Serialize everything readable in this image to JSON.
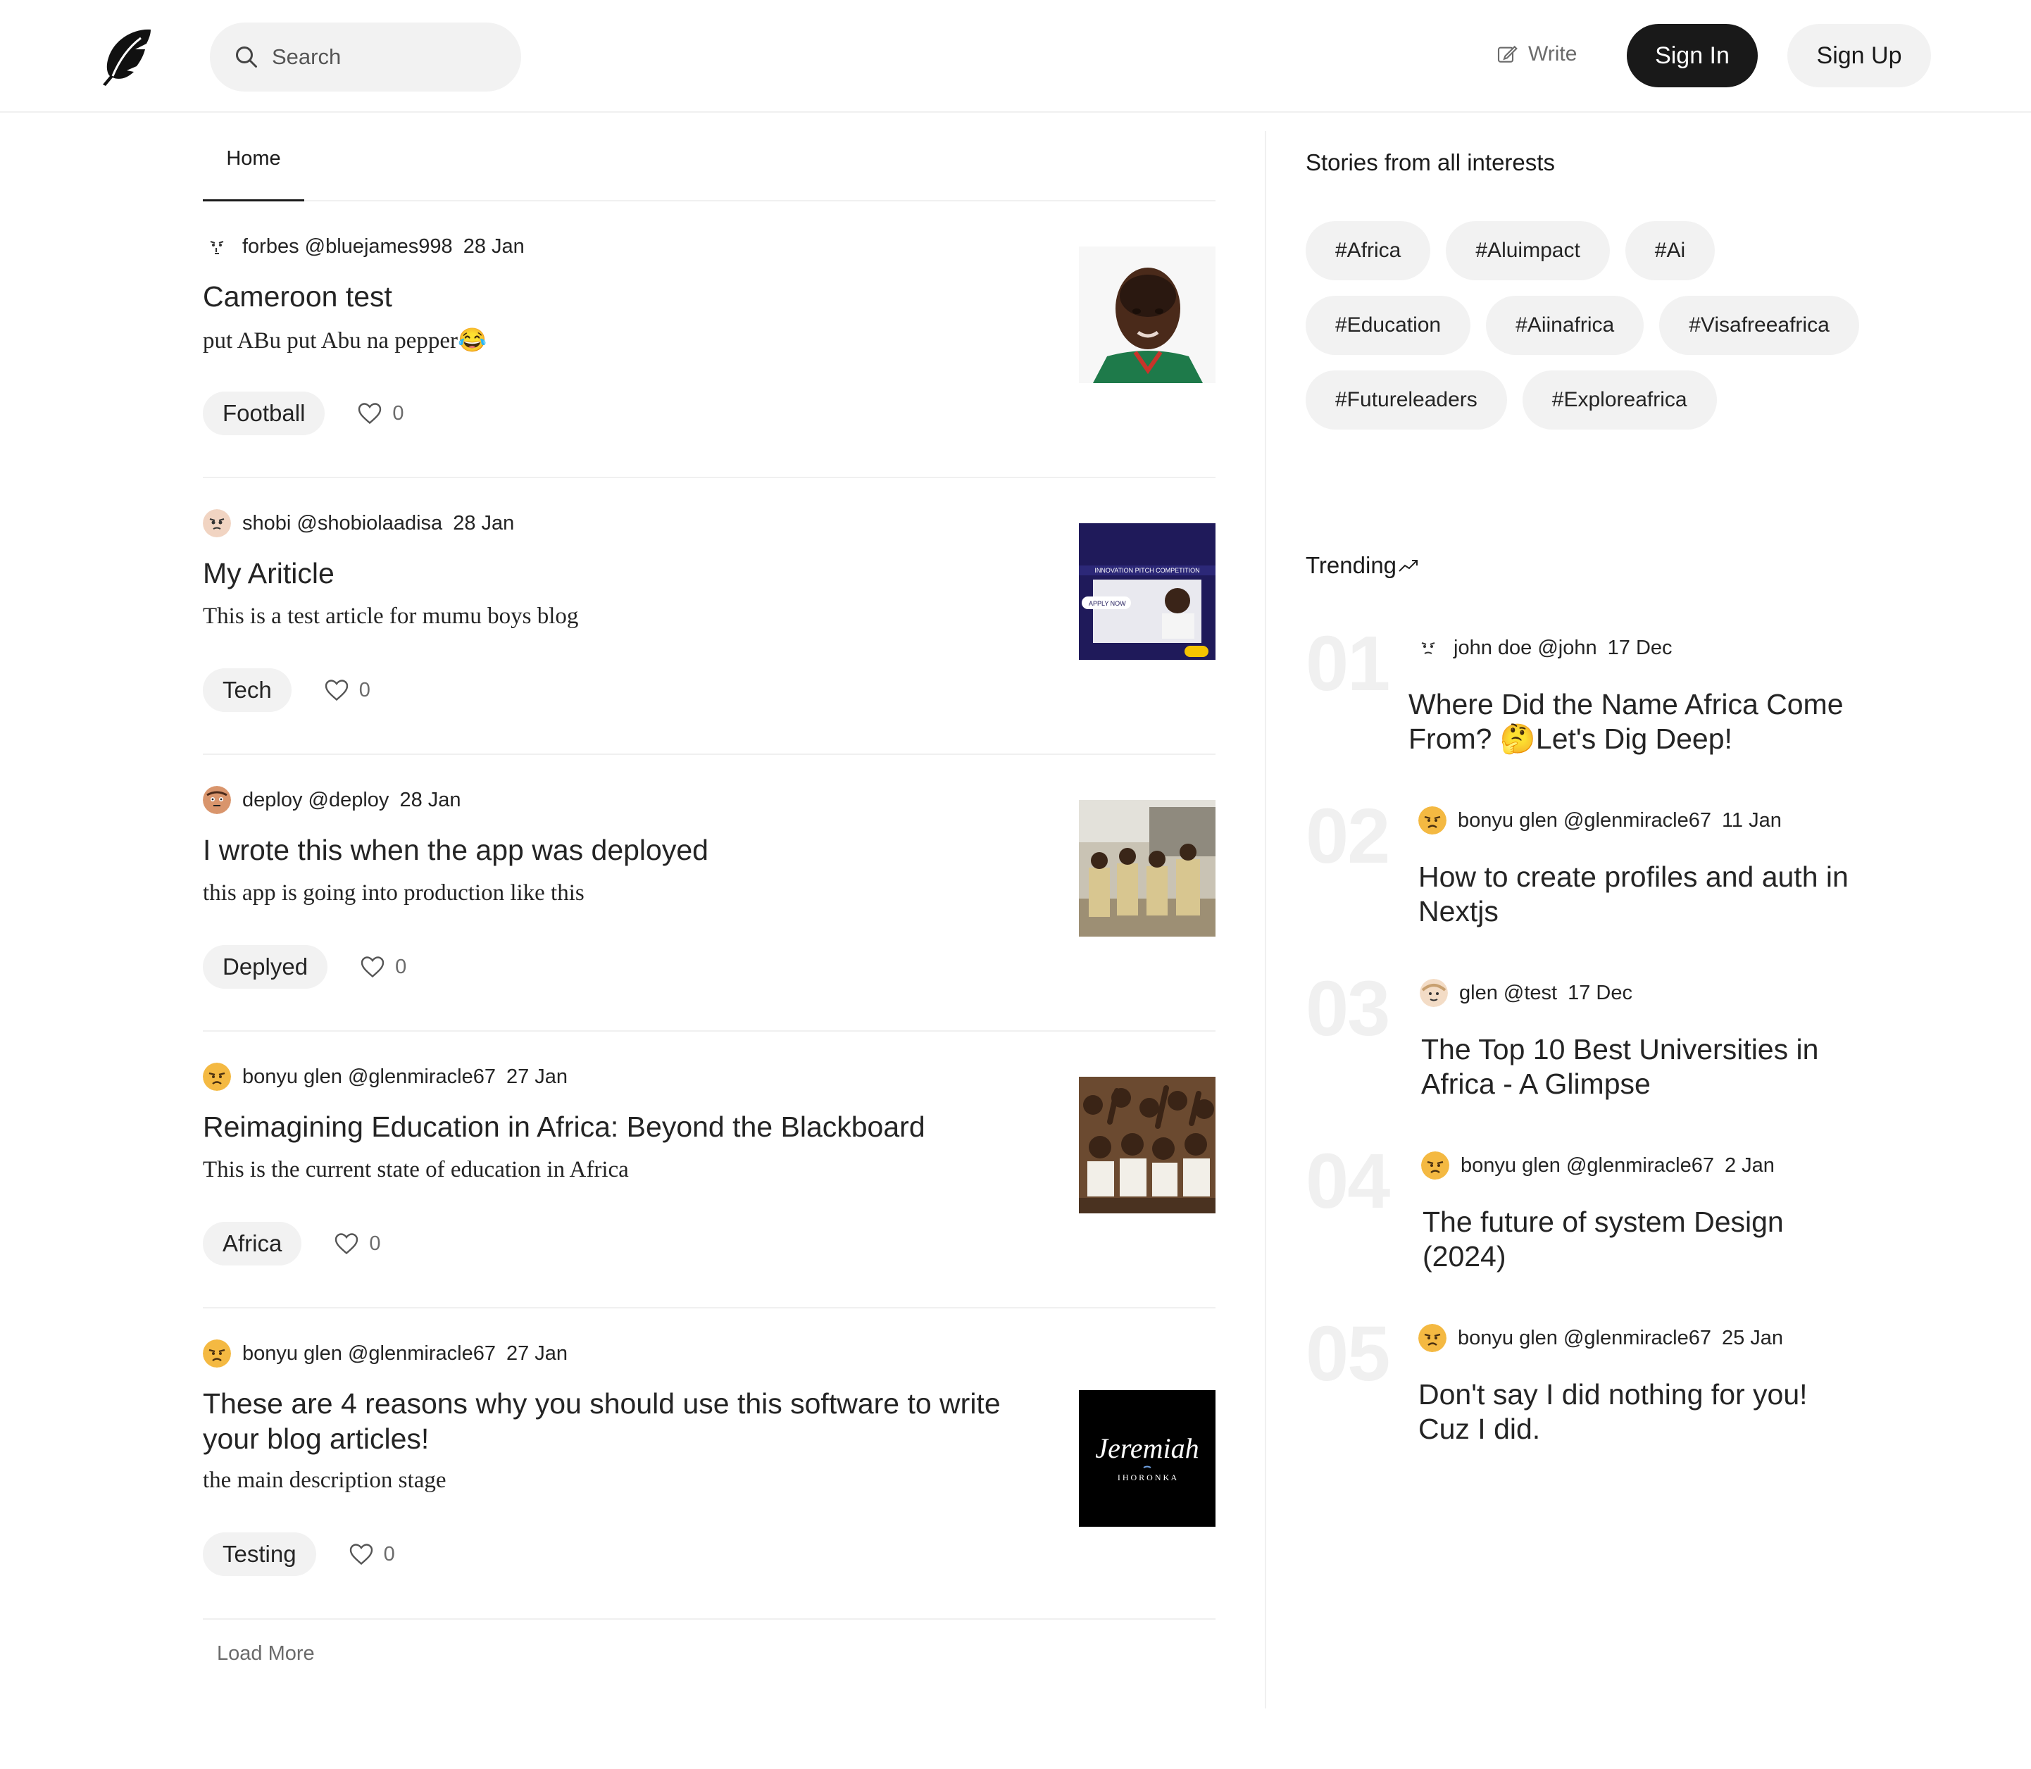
{
  "header": {
    "search_placeholder": "Search",
    "write_label": "Write",
    "signin_label": "Sign In",
    "signup_label": "Sign Up"
  },
  "tabs": [
    {
      "label": "Home"
    }
  ],
  "posts": [
    {
      "author": "forbes",
      "handle": "@bluejames998",
      "date": "28 Jan",
      "title": "Cameroon test",
      "description": "put ABu put Abu na pepper😂",
      "tag": "Football",
      "likes": "0"
    },
    {
      "author": "shobi",
      "handle": "@shobiolaadisa",
      "date": "28 Jan",
      "title": "My Ariticle",
      "description": "This is a test article for mumu boys blog",
      "tag": "Tech",
      "likes": "0"
    },
    {
      "author": "deploy",
      "handle": "@deploy",
      "date": "28 Jan",
      "title": "I wrote this when the app was deployed",
      "description": "this app is going into production like this",
      "tag": "Deplyed",
      "likes": "0"
    },
    {
      "author": "bonyu glen",
      "handle": "@glenmiracle67",
      "date": "27 Jan",
      "title": "Reimagining Education in Africa: Beyond the Blackboard",
      "description": "This is the current state of education in Africa",
      "tag": "Africa",
      "likes": "0"
    },
    {
      "author": "bonyu glen",
      "handle": "@glenmiracle67",
      "date": "27 Jan",
      "title": "These are 4 reasons why you should use this software to write your blog articles!",
      "description": "the main description stage",
      "tag": "Testing",
      "likes": "0"
    }
  ],
  "thumb_texts": {
    "pitch_headline": "INNOVATION PITCH COMPETITION",
    "pitch_apply": "APPLY NOW",
    "logo_script": "Jeremiah",
    "logo_sub": "I H O R O N K A"
  },
  "load_more_label": "Load More",
  "sidebar": {
    "stories_heading": "Stories from all interests",
    "chips": [
      "#Africa",
      "#Aluimpact",
      "#Ai",
      "#Education",
      "#Aiinafrica",
      "#Visafreeafrica",
      "#Futureleaders",
      "#Exploreafrica"
    ],
    "trending_heading": "Trending",
    "trending": [
      {
        "rank": "01",
        "author": "john doe",
        "handle": "@john",
        "date": "17 Dec",
        "title": "Where Did the Name Africa Come From? 🤔Let's Dig Deep!"
      },
      {
        "rank": "02",
        "author": "bonyu glen",
        "handle": "@glenmiracle67",
        "date": "11 Jan",
        "title": "How to create profiles and auth in Nextjs"
      },
      {
        "rank": "03",
        "author": "glen",
        "handle": "@test",
        "date": "17 Dec",
        "title": "The Top 10 Best Universities in Africa - A Glimpse"
      },
      {
        "rank": "04",
        "author": "bonyu glen",
        "handle": "@glenmiracle67",
        "date": "2 Jan",
        "title": "The future of system Design (2024)"
      },
      {
        "rank": "05",
        "author": "bonyu glen",
        "handle": "@glenmiracle67",
        "date": "25 Jan",
        "title": "Don't say I did nothing for you! Cuz I did."
      }
    ]
  }
}
